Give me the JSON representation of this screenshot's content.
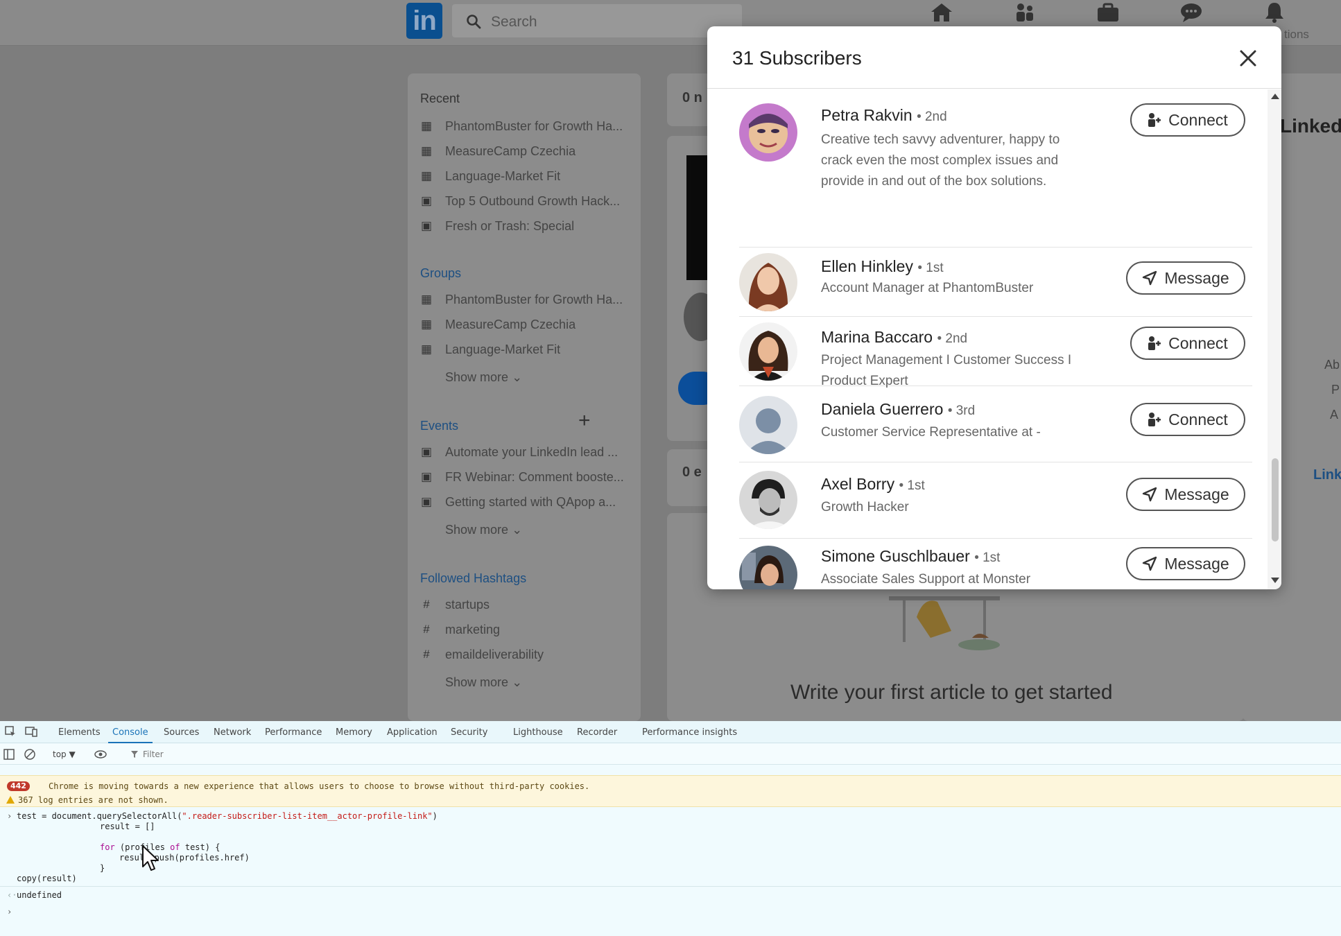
{
  "header": {
    "logo": "in",
    "search_placeholder": "Search",
    "nav_label_notifications": "tions"
  },
  "left": {
    "recent_title": "Recent",
    "recent": [
      "PhantomBuster for Growth Ha...",
      "MeasureCamp Czechia",
      "Language-Market Fit",
      "Top 5 Outbound Growth Hack...",
      "Fresh or Trash: Special"
    ],
    "groups_title": "Groups",
    "groups": [
      "PhantomBuster for Growth Ha...",
      "MeasureCamp Czechia",
      "Language-Market Fit"
    ],
    "groups_more": "Show more",
    "events_title": "Events",
    "events": [
      "Automate your LinkedIn lead ...",
      "FR Webinar: Comment booste...",
      "Getting started with QApop a..."
    ],
    "events_more": "Show more",
    "hashtags_title": "Followed Hashtags",
    "hashtags": [
      "startups",
      "marketing",
      "emaildeliverability"
    ],
    "hashtags_more": "Show more"
  },
  "middle": {
    "count_top": "0 n",
    "count_mid": "0 e",
    "write_article": "Write your first article to get started"
  },
  "right": {
    "title_partial": "Linked",
    "ab": "Ab",
    "p": "P",
    "a": "A",
    "link": "Link"
  },
  "modal": {
    "title": "31 Subscribers",
    "subscribers": [
      {
        "name": "Petra Rakvin",
        "degree": "• 2nd",
        "headline": "Creative tech savvy adventurer, happy to crack even the most complex issues and provide in and out of the box solutions.",
        "action": "Connect"
      },
      {
        "name": "Ellen Hinkley",
        "degree": "• 1st",
        "headline": "Account Manager at PhantomBuster",
        "action": "Message"
      },
      {
        "name": "Marina Baccaro",
        "degree": "• 2nd",
        "headline": "Project Management I Customer Success I Product Expert",
        "action": "Connect"
      },
      {
        "name": "Daniela Guerrero",
        "degree": "• 3rd",
        "headline": "Customer Service Representative at -",
        "action": "Connect"
      },
      {
        "name": "Axel Borry",
        "degree": "• 1st",
        "headline": "Growth Hacker",
        "action": "Message"
      },
      {
        "name": "Simone Guschlbauer",
        "degree": "• 1st",
        "headline": "Associate Sales Support at Monster",
        "action": "Message"
      }
    ]
  },
  "devtools": {
    "tabs": [
      "Elements",
      "Console",
      "Sources",
      "Network",
      "Performance",
      "Memory",
      "Application",
      "Security",
      "Lighthouse",
      "Recorder",
      "Performance insights"
    ],
    "context": "top ▼",
    "filter_placeholder": "Filter",
    "badge": "442",
    "warning1": "Chrome is moving towards a new experience that allows users to choose to browse without third-party cookies.",
    "warning2": "367 log entries are not shown.",
    "code_line1_pre": "test = document.querySelectorAll(",
    "code_line1_str": "\".reader-subscriber-list-item__actor-profile-link\"",
    "code_line1_post": ")",
    "code_line2": "result = []",
    "code_line3_kw": "for",
    "code_line3_a": " (profiles ",
    "code_line3_kw2": "of",
    "code_line3_b": " test) {",
    "code_line4": "result.push(profiles.href)",
    "code_line5": "}",
    "code_line6": "copy(result)",
    "undefined_text": "undefined"
  }
}
